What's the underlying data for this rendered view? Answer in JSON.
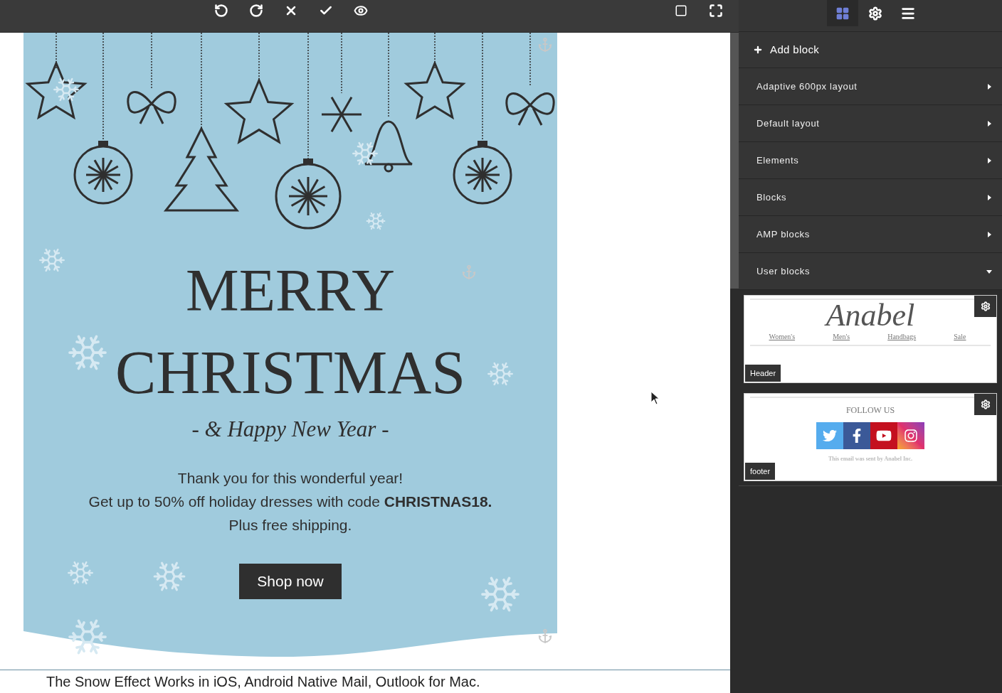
{
  "toolbar": {
    "left_tools": [
      {
        "kind": "undo"
      },
      {
        "kind": "redo"
      },
      {
        "kind": "cancel"
      },
      {
        "kind": "apply"
      },
      {
        "kind": "preview"
      }
    ],
    "right_tools": [
      {
        "kind": "frame"
      },
      {
        "kind": "fullscreen"
      }
    ]
  },
  "email": {
    "title_line_1": "MERRY",
    "title_line_2": "CHRISTMAS",
    "subtitle": "- & Happy New Year -",
    "body_lines": [
      "Thank you for this wonderful year!",
      "Get up to 50% off holiday dresses with code **CHRISTNAS18.**",
      "Plus free shipping."
    ],
    "button": "Shop now"
  },
  "canvas_note": "The Snow Effect Works in iOS, Android Native Mail, Outlook for Mac.",
  "sidebar": {
    "tabs": [
      {
        "kind": "blocks",
        "selected": true
      },
      {
        "kind": "settings",
        "selected": false
      },
      {
        "kind": "menu",
        "selected": false
      }
    ],
    "add_block": "Add block",
    "sections": [
      {
        "label": "Adaptive 600px layout",
        "expanded": false
      },
      {
        "label": "Default layout",
        "expanded": false
      },
      {
        "label": "Elements",
        "expanded": false
      },
      {
        "label": "Blocks",
        "expanded": false
      },
      {
        "label": "AMP blocks",
        "expanded": false
      },
      {
        "label": "User blocks",
        "expanded": true
      }
    ],
    "user_blocks": [
      {
        "kind": "header",
        "label": "Header",
        "logo": "Anabel",
        "links": [
          "Women's",
          "Men's",
          "Handbags",
          "Sale"
        ]
      },
      {
        "kind": "footer",
        "label": "footer",
        "heading": "FOLLOW US",
        "note": "This email was sent by Anabel Inc."
      }
    ]
  }
}
